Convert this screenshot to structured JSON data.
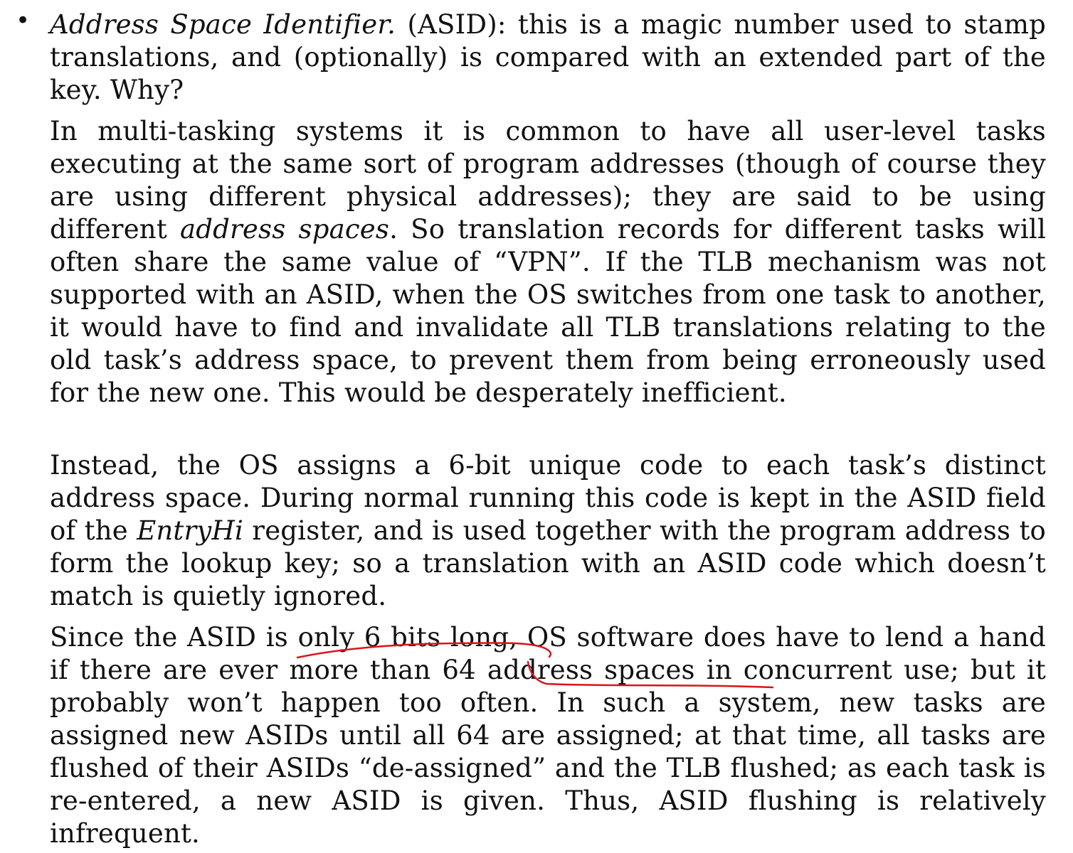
{
  "bullet_item": {
    "bullet_glyph": "•",
    "term": "Address Space Identifier.",
    "intro": " (ASID): this is a magic number used to stamp translations, and (optionally) is compared with an extended part of the key. Why?"
  },
  "paragraph2": {
    "part1": "In multi-tasking systems it is common to have all user-level tasks executing at the same sort of program addresses (though of course they are using different physical addresses); they are said to be using different ",
    "em": "address spaces",
    "part2": ". So translation records for different tasks will often share the same value of “VPN”. If the TLB mechanism was not supported with an ASID, when the OS switches from one task to another, it would have to find and invalidate all TLB translations relating to the old task’s address space, to prevent them from being erroneously used for the new one. This would be desperately inefficient."
  },
  "paragraph3": {
    "part1": "Instead, the OS assigns a 6-bit unique code to each task’s distinct address space. During normal running this code is kept in the ASID field of the ",
    "em": "EntryHi",
    "part2": " register, and is used together with the program address to form the lookup key; so a translation with an ASID code which doesn’t match is quietly ignored."
  },
  "paragraph4": {
    "part1": "Since the ASID is ",
    "underline1": "only 6 bits long",
    "part2": ", OS software does have to lend a hand if there are ever more than ",
    "underline2": "64 address spaces",
    "part3": " in concurrent use; but it probably won’t happen too often. In such a system, new tasks are assigned new ASIDs until all 64 are assigned; at that time, all tasks are flushed of their ASIDs “de-assigned” and the TLB flushed; as each task is re-entered, a new ASID is given. Thus, ASID flushing is relatively infrequent."
  },
  "annotation_color": "#d9141b"
}
